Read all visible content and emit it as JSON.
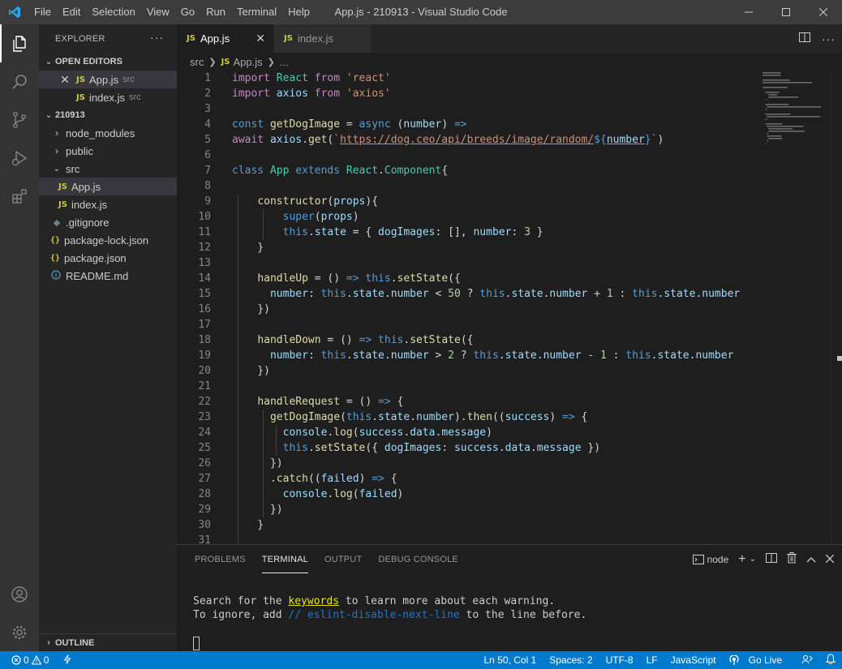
{
  "window": {
    "title": "App.js - 210913 - Visual Studio Code"
  },
  "menu": [
    "File",
    "Edit",
    "Selection",
    "View",
    "Go",
    "Run",
    "Terminal",
    "Help"
  ],
  "sidebar": {
    "header": "EXPLORER",
    "open_editors": {
      "label": "OPEN EDITORS",
      "items": [
        {
          "icon": "JS",
          "name": "App.js",
          "desc": "src"
        },
        {
          "icon": "JS",
          "name": "index.js",
          "desc": "src"
        }
      ]
    },
    "project": {
      "label": "210913",
      "items": [
        {
          "icon": "folder",
          "name": "node_modules"
        },
        {
          "icon": "folder",
          "name": "public"
        },
        {
          "icon": "folder-open",
          "name": "src"
        },
        {
          "icon": "JS",
          "name": "App.js"
        },
        {
          "icon": "JS",
          "name": "index.js"
        },
        {
          "icon": "git",
          "name": ".gitignore"
        },
        {
          "icon": "{}",
          "name": "package-lock.json"
        },
        {
          "icon": "{}",
          "name": "package.json"
        },
        {
          "icon": "info",
          "name": "README.md"
        }
      ]
    },
    "outline": "OUTLINE"
  },
  "tabs": [
    {
      "icon": "JS",
      "label": "App.js",
      "active": true
    },
    {
      "icon": "JS",
      "label": "index.js",
      "active": false
    }
  ],
  "breadcrumb": {
    "folder": "src",
    "file": "App.js",
    "more": "..."
  },
  "editor": {
    "line_numbers": [
      "1",
      "2",
      "3",
      "4",
      "5",
      "6",
      "7",
      "8",
      "9",
      "10",
      "11",
      "12",
      "13",
      "14",
      "15",
      "16",
      "17",
      "18",
      "19",
      "20",
      "21",
      "22",
      "23",
      "24",
      "25",
      "26",
      "27",
      "28",
      "29",
      "30",
      "31"
    ],
    "lines": [
      [
        [
          "c",
          "import"
        ],
        [
          "",
          "React"
        ],
        [
          "c",
          "from"
        ],
        [
          "s",
          "'react'"
        ]
      ],
      [
        [
          "c",
          "import"
        ],
        [
          "",
          "axios"
        ],
        [
          "c",
          "from"
        ],
        [
          "s",
          "'axios'"
        ]
      ],
      [],
      [
        [
          "k",
          "const"
        ],
        [
          "f",
          "getDogImage"
        ],
        [
          "",
          "="
        ],
        [
          "k",
          "async"
        ],
        [
          "",
          "("
        ],
        [
          "v",
          "number"
        ],
        [
          "",
          " ) =>"
        ]
      ]
    ],
    "text": [
      "import React from 'react'",
      "import axios from 'axios'",
      "",
      "const getDogImage = async (number) =>",
      "await axios.get(`https://dog.ceo/api/breeds/image/random/${number}`)",
      "",
      "class App extends React.Component{",
      "",
      "    constructor(props){",
      "        super(props)",
      "        this.state = { dogImages: [], number: 3 }",
      "    }",
      "",
      "    handleUp = () => this.setState({",
      "      number: this.state.number < 50 ? this.state.number + 1 : this.state.number",
      "    })",
      "",
      "    handleDown = () => this.setState({",
      "      number: this.state.number > 2 ? this.state.number - 1 : this.state.number",
      "    })",
      "",
      "    handleRequest = () => {",
      "      getDogImage(this.state.number).then((success) => {",
      "        console.log(success.data.message)",
      "        this.setState({ dogImages: success.data.message })",
      "      })",
      "      .catch((failed) => {",
      "        console.log(failed)",
      "      })",
      "    }",
      ""
    ]
  },
  "panel": {
    "tabs": [
      "PROBLEMS",
      "TERMINAL",
      "OUTPUT",
      "DEBUG CONSOLE"
    ],
    "active_tab": "TERMINAL",
    "terminal_name": "node",
    "terminal": {
      "line1_a": "Search for the ",
      "line1_kw": "keywords",
      "line1_b": " to learn more about each warning.",
      "line2_a": "To ignore, add ",
      "line2_cm": "// eslint-disable-next-line",
      "line2_b": " to the line before."
    }
  },
  "status": {
    "errors": "0",
    "warnings": "0",
    "position": "Ln 50, Col 1",
    "spaces": "Spaces: 2",
    "encoding": "UTF-8",
    "eol": "LF",
    "language": "JavaScript",
    "go_live": "Go Live"
  }
}
